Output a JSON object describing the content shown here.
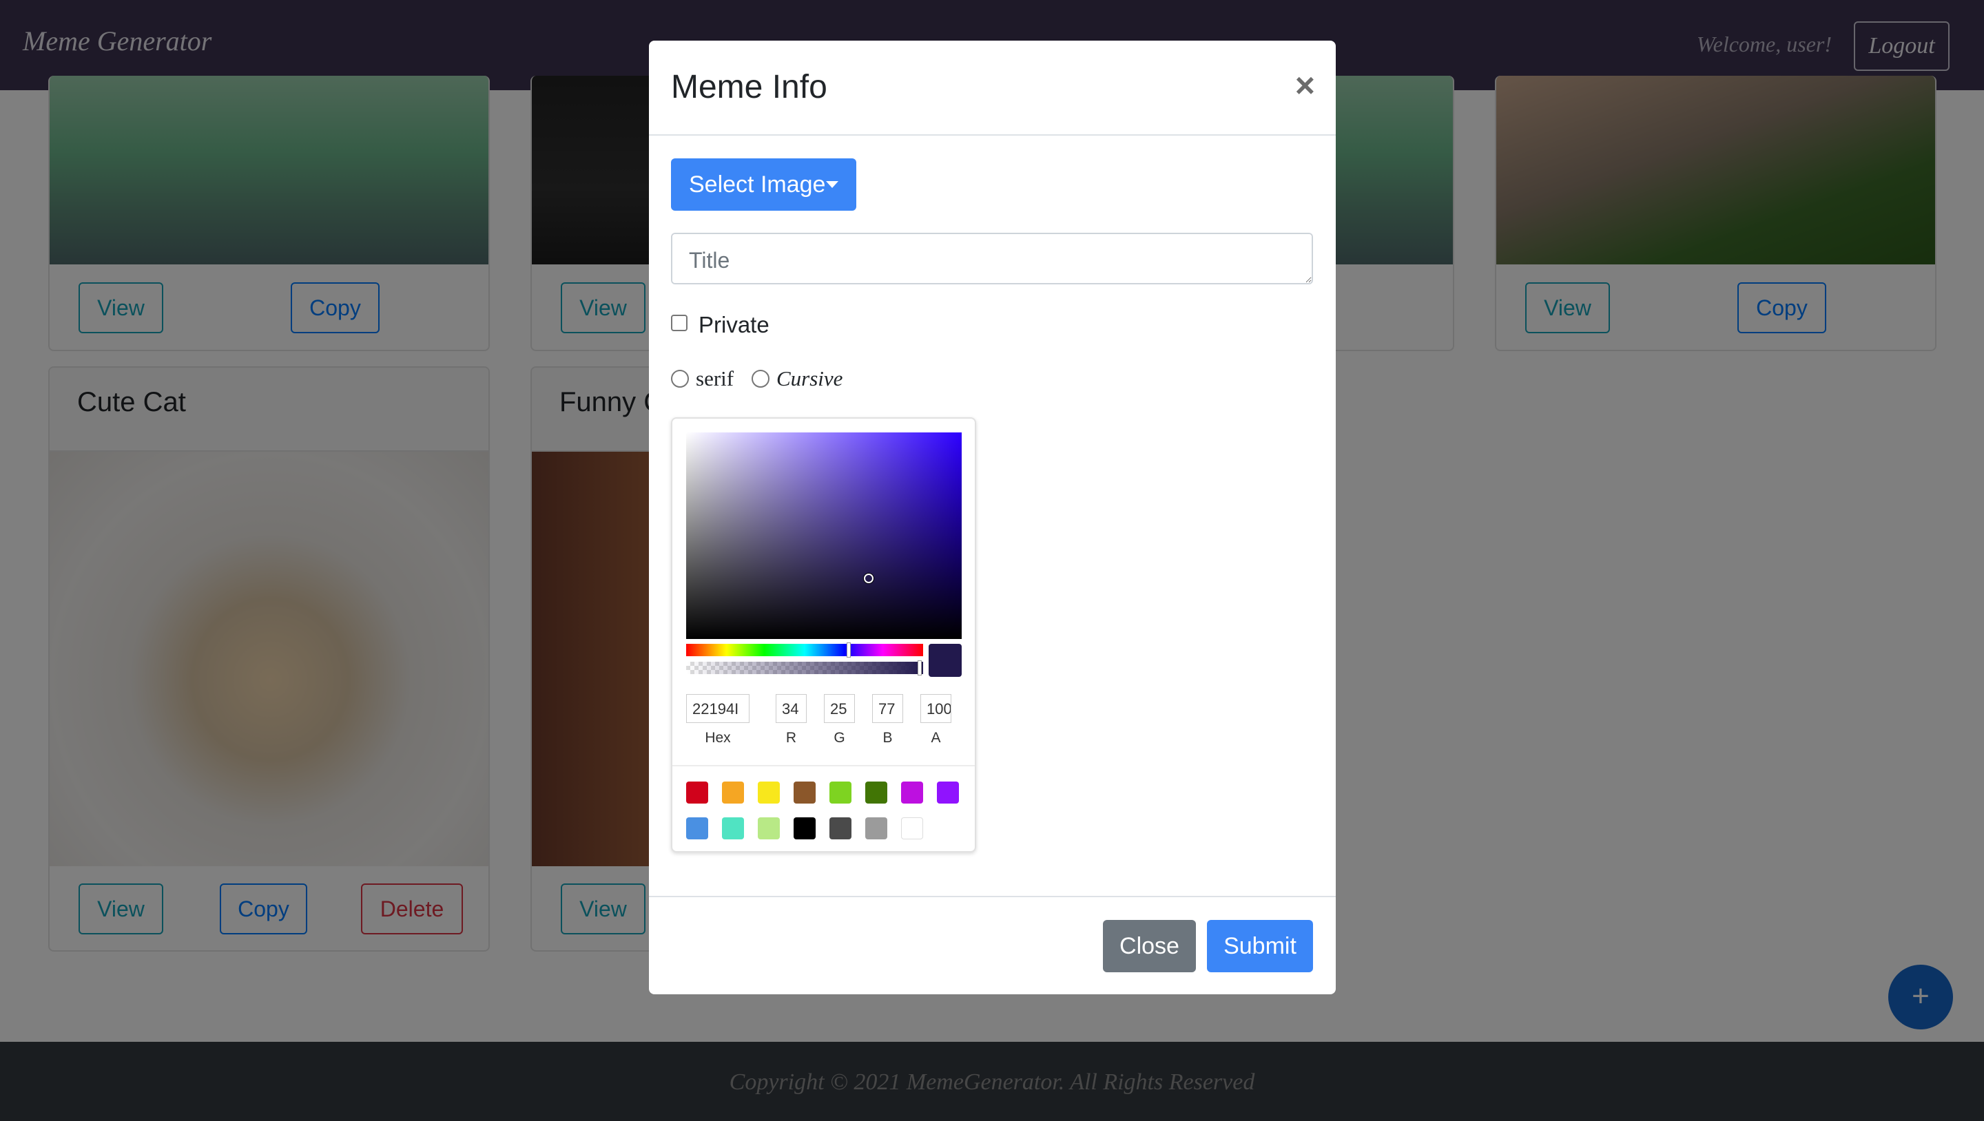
{
  "navbar": {
    "brand": "Meme Generator",
    "welcome": "Welcome, user!",
    "logout_label": "Logout"
  },
  "cards": {
    "top_view_label": "View",
    "top_copy_label": "Copy",
    "row2": [
      {
        "title": "Cute Cat",
        "view_label": "View",
        "copy_label": "Copy",
        "delete_label": "Delete"
      },
      {
        "title": "Funny C",
        "view_label": "View"
      }
    ]
  },
  "fab": {
    "label": "+"
  },
  "footer": {
    "text": "Copyright © 2021 MemeGenerator. All Rights Reserved"
  },
  "modal": {
    "title": "Meme Info",
    "close_icon": "×",
    "select_image_label": "Select Image",
    "title_placeholder": "Title",
    "private_label": "Private",
    "font_options": [
      "serif",
      "Cursive"
    ],
    "color_picker": {
      "current_color": "#22194d",
      "hue_color": "#2d00ff",
      "fields": [
        {
          "label": "Hex",
          "value": "22194I"
        },
        {
          "label": "R",
          "value": "34"
        },
        {
          "label": "G",
          "value": "25"
        },
        {
          "label": "B",
          "value": "77"
        },
        {
          "label": "A",
          "value": "100"
        }
      ],
      "presets": [
        "#d0021b",
        "#f5a623",
        "#f8e71c",
        "#8b572a",
        "#7ed321",
        "#417505",
        "#bd10e0",
        "#9013fe",
        "#4a90e2",
        "#50e3c2",
        "#b8e986",
        "#000000",
        "#4a4a4a",
        "#9b9b9b",
        "#ffffff"
      ]
    },
    "close_button_label": "Close",
    "submit_button_label": "Submit"
  }
}
